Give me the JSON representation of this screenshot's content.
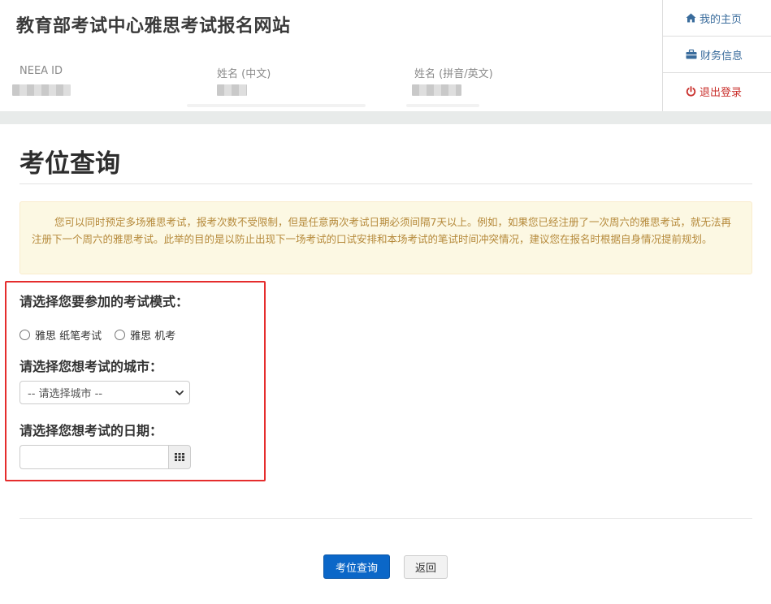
{
  "header": {
    "site_title": "教育部考试中心雅思考试报名网站",
    "fields": [
      {
        "label": "NEEA ID"
      },
      {
        "label": "姓名 (中文)"
      },
      {
        "label": "姓名 (拼音/英文)"
      }
    ]
  },
  "side_nav": {
    "items": [
      {
        "label": "我的主页",
        "icon": "home-icon"
      },
      {
        "label": "财务信息",
        "icon": "briefcase-icon"
      },
      {
        "label": "退出登录",
        "icon": "power-icon"
      }
    ]
  },
  "page": {
    "title": "考位查询",
    "notice": "您可以同时预定多场雅思考试，报考次数不受限制，但是任意两次考试日期必须间隔7天以上。例如，如果您已经注册了一次周六的雅思考试，就无法再注册下一个周六的雅思考试。此举的目的是以防止出现下一场考试的口试安排和本场考试的笔试时间冲突情况，建议您在报名时根据自身情况提前规划。"
  },
  "form": {
    "mode_label": "请选择您要参加的考试模式：",
    "mode_options": [
      "雅思 纸笔考试",
      "雅思 机考"
    ],
    "city_label": "请选择您想考试的城市：",
    "city_selected": "-- 请选择城市 --",
    "date_label": "请选择您想考试的日期：",
    "date_value": ""
  },
  "buttons": {
    "search": "考位查询",
    "back": "返回"
  },
  "colors": {
    "primary": "#0b67c8",
    "highlight_border": "#e52d2d",
    "notice_bg": "#fcf8e3",
    "notice_text": "#b5893a",
    "nav_link": "#3a6c9c",
    "logout": "#c9302c"
  }
}
